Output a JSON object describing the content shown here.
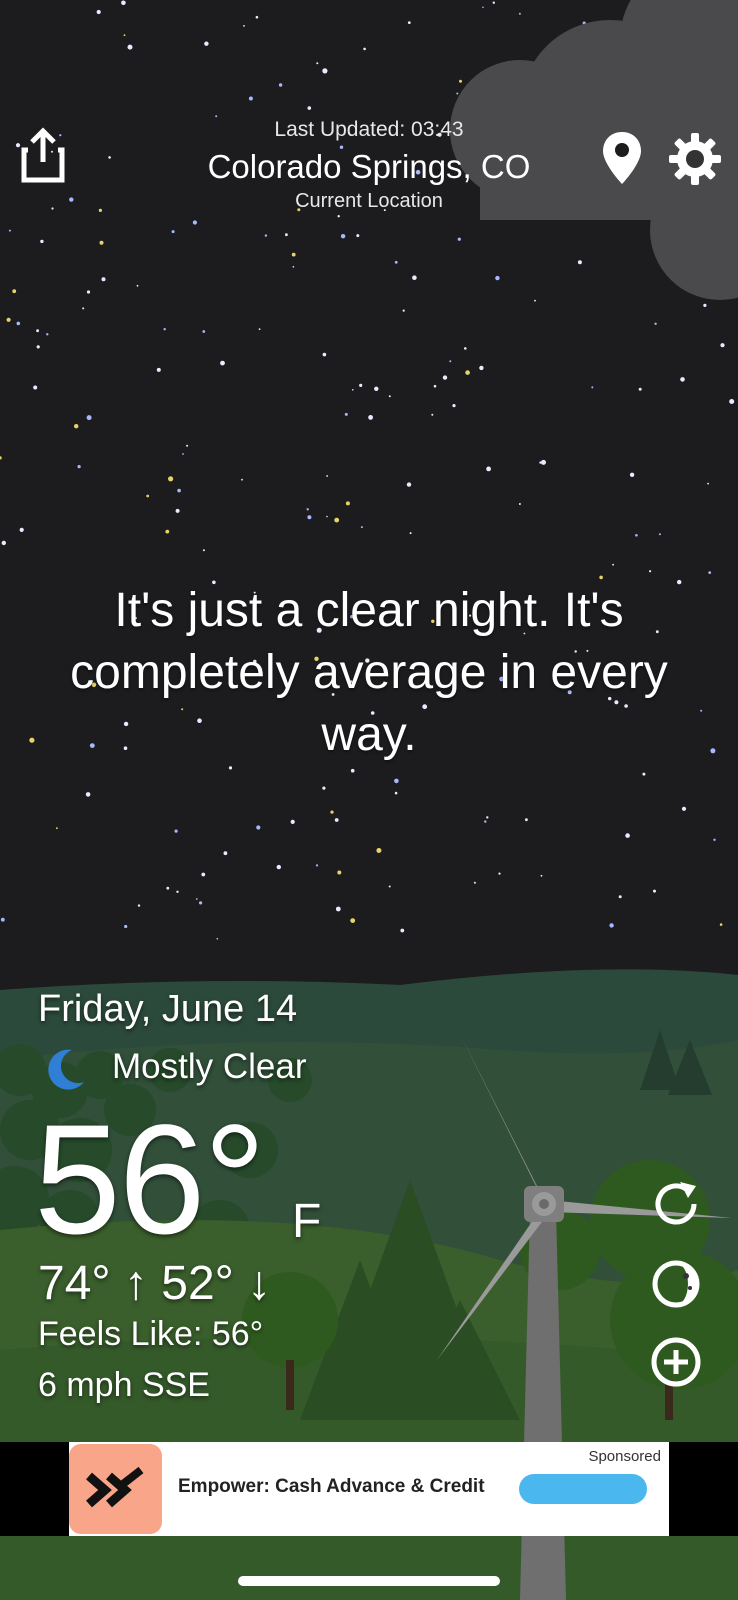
{
  "header": {
    "last_updated": "Last Updated: 03:43",
    "location": "Colorado Springs, CO",
    "location_sub": "Current Location"
  },
  "quip": "It's just a clear night. It's completely average in every way.",
  "weather": {
    "date": "Friday, June 14",
    "condition": "Mostly Clear",
    "temperature": "56°",
    "unit": "F",
    "high_low": "74° ↑ 52° ↓",
    "feels_like": "Feels Like: 56°",
    "wind": "6 mph SSE"
  },
  "icons": {
    "share": "share-icon",
    "location": "location-pin-icon",
    "settings": "gear-icon",
    "condition": "crescent-moon-icon",
    "refresh": "refresh-icon",
    "moon_phase": "moon-phase-icon",
    "add": "add-circle-icon"
  },
  "ad": {
    "sponsored": "Sponsored",
    "title": "Empower: Cash Advance & Credit",
    "cta": ""
  },
  "colors": {
    "sky": "#1c1c1e",
    "hills_far": "#2c4a3c",
    "hills_near": "#3a5e2c",
    "moon_icon": "#2f7fd6",
    "ad_cta": "#4ab7ee",
    "ad_logo_bg": "#f8a58a"
  }
}
